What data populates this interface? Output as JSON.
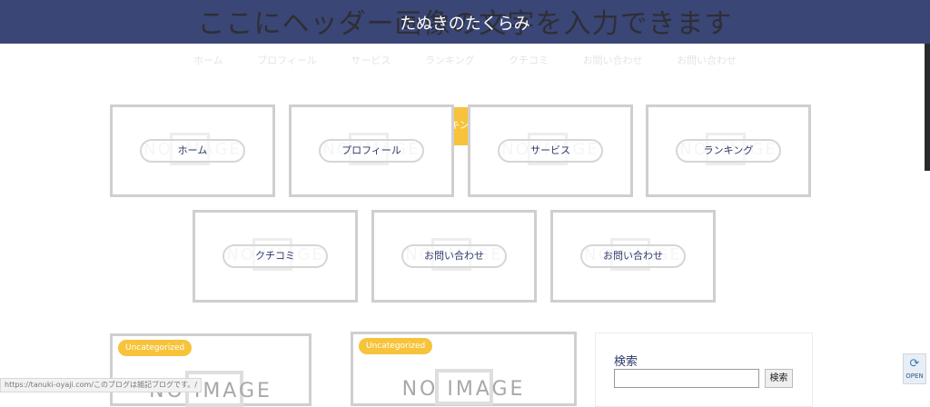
{
  "header": {
    "bg_text": "ここにヘッダー画像の文字を入力できます",
    "site_title": "たぬきのたくらみ"
  },
  "nav": {
    "items": [
      "ホーム",
      "プロフィール",
      "サービス",
      "ランキング",
      "クチコミ",
      "お問い合わせ",
      "お問い合わせ"
    ]
  },
  "peek_text": "キン",
  "cards": {
    "watermark": "NO IMAGE",
    "row1": [
      "ホーム",
      "プロフィール",
      "サービス",
      "ランキング"
    ],
    "row2": [
      "クチコミ",
      "お問い合わせ",
      "お問い合わせ"
    ]
  },
  "posts": [
    {
      "category": "Uncategorized",
      "image_text": "NO IMAGE"
    },
    {
      "category": "Uncategorized",
      "image_text": "NO IMAGE"
    }
  ],
  "sidebar": {
    "search_title": "検索",
    "search_button": "検索",
    "search_value": ""
  },
  "status_bar": {
    "text": "https://tanuki-oyaji.com/このブログは雑記ブログです。/"
  },
  "open_widget": {
    "label": "OPEN",
    "icon": "refresh-icon"
  },
  "colors": {
    "header": "#3a4675",
    "accent": "#f6c33a",
    "text_blue": "#2d3a6a"
  }
}
